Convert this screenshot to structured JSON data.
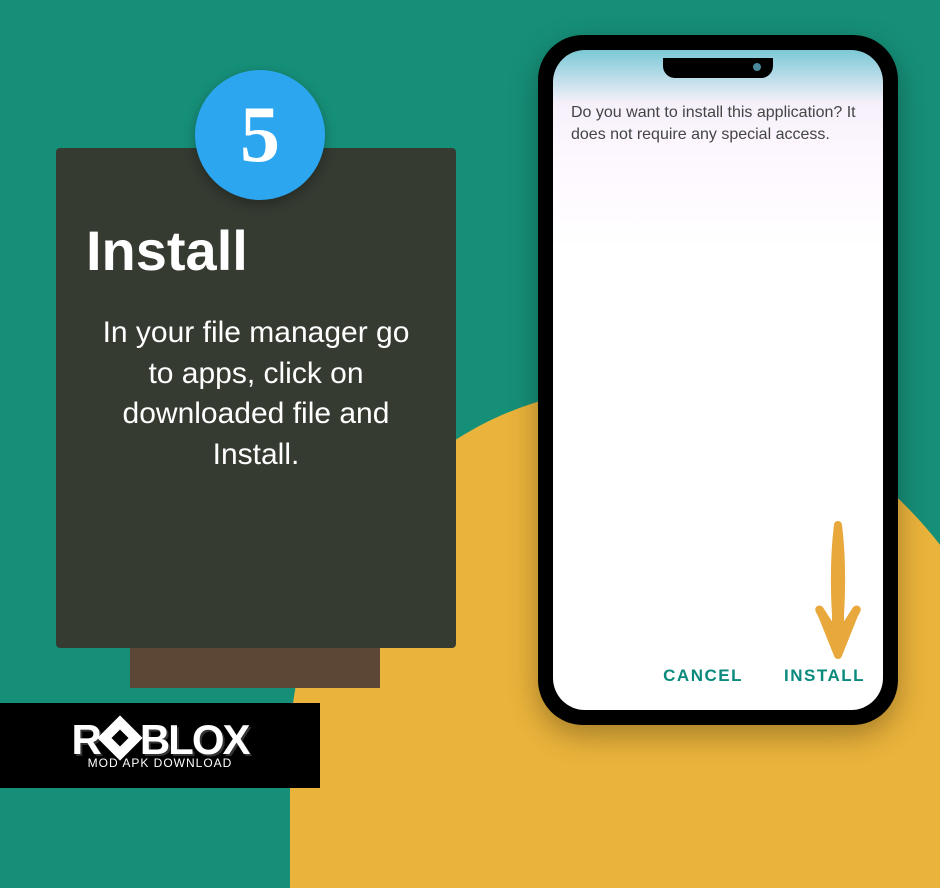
{
  "step": {
    "number": "5",
    "title": "Install",
    "description": "In your file manager go to apps, click on downloaded file and Install."
  },
  "phone": {
    "message": "Do you want to install this application? It does not require any special access.",
    "cancel_btn": "CANCEL",
    "install_btn": "INSTALL"
  },
  "logo": {
    "main": "R",
    "main2": "BLOX",
    "subtext": "MOD APK DOWNLOAD"
  },
  "colors": {
    "background": "#168f78",
    "accent_yellow": "#eab33b",
    "card_bg": "#353b31",
    "circle_blue": "#2ba6ef",
    "arrow": "#e8a83b",
    "phone_btn": "#0a8a7c"
  }
}
